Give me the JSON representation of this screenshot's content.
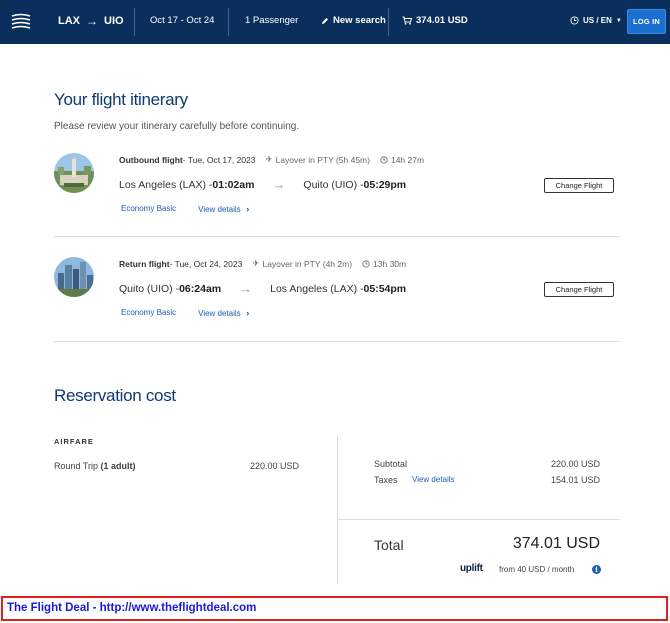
{
  "header": {
    "origin": "LAX",
    "destination": "UIO",
    "dates": "Oct 17 - Oct 24",
    "passengers": "1 Passenger",
    "new_search": "New search",
    "cart_total": "374.01 USD",
    "locale": "US / EN",
    "login": "LOG IN"
  },
  "itinerary": {
    "title": "Your flight itinerary",
    "subtitle": "Please review your itinerary carefully before continuing.",
    "flights": [
      {
        "kind": "Outbound flight",
        "date": " - Tue, Oct 17, 2023",
        "layover": "Layover in PTY (5h 45m)",
        "duration": "14h 27m",
        "from_city": "Los Angeles (LAX) - ",
        "from_time": "01:02am",
        "to_city": "Quito (UIO) - ",
        "to_time": "05:29pm",
        "fare_class": "Economy Basic",
        "view_details": "View details",
        "change": "Change Flight"
      },
      {
        "kind": "Return flight",
        "date": " - Tue, Oct 24, 2023",
        "layover": "Layover in PTY (4h 2m)",
        "duration": "13h 30m",
        "from_city": "Quito (UIO) - ",
        "from_time": "06:24am",
        "to_city": "Los Angeles (LAX) - ",
        "to_time": "05:54pm",
        "fare_class": "Economy Basic",
        "view_details": "View details",
        "change": "Change Flight"
      }
    ]
  },
  "cost": {
    "title": "Reservation cost",
    "airfare_label": "AIRFARE",
    "trip_label": "Round Trip ",
    "trip_pax": "(1 adult)",
    "trip_amount": "220.00 USD",
    "subtotal_label": "Subtotal",
    "subtotal_amount": "220.00 USD",
    "taxes_label": "Taxes",
    "taxes_link": "View details",
    "taxes_amount": "154.01 USD",
    "total_label": "Total",
    "total_amount": "374.01 USD",
    "uplift_brand": "uplift",
    "uplift_text": "from 40 USD  / month"
  },
  "banner": {
    "text": "The Flight Deal - http://www.theflightdeal.com"
  },
  "colors": {
    "header_bg": "#0a2f5c",
    "accent": "#1a6fd1",
    "title": "#0e3a6e",
    "banner_border": "#e02020",
    "banner_text": "#1a1ad8"
  }
}
